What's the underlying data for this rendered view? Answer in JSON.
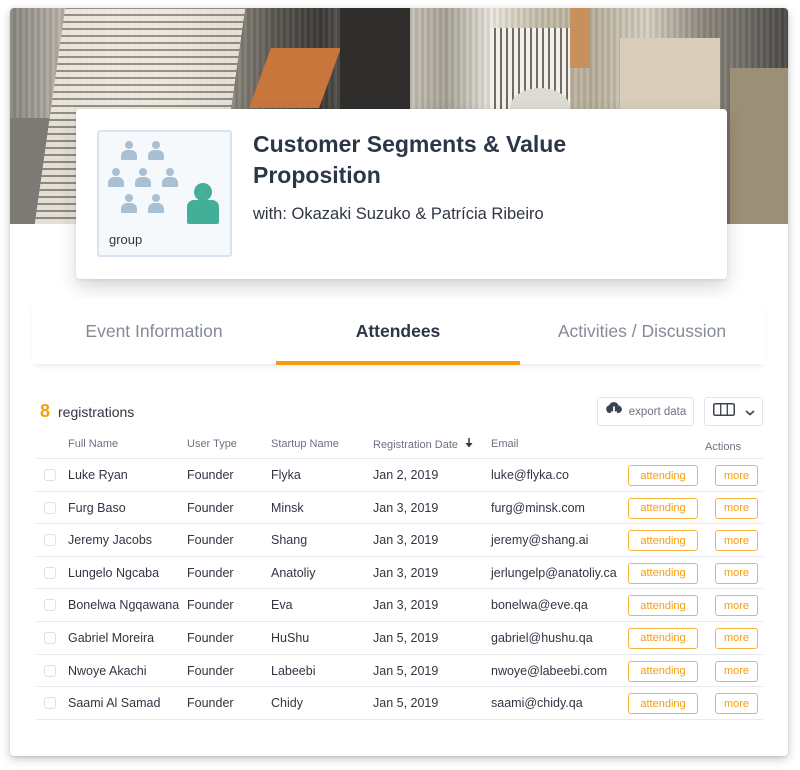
{
  "event": {
    "image_label": "group",
    "title": "Customer Segments & Value Proposition",
    "hosts": "with: Okazaki Suzuko & Patrícia Ribeiro"
  },
  "tabs": [
    {
      "label": "Event Information",
      "active": false
    },
    {
      "label": "Attendees",
      "active": true
    },
    {
      "label": "Activities / Discussion",
      "active": false
    }
  ],
  "registrations": {
    "count": "8",
    "label": "registrations"
  },
  "toolbar": {
    "export_label": "export data",
    "export_icon": "cloud-download-icon",
    "columns_icon": "columns-icon",
    "columns_dropdown_icon": "chevron-down-icon"
  },
  "table": {
    "columns": {
      "name": "Full Name",
      "type": "User Type",
      "startup": "Startup Name",
      "date": "Registration Date",
      "email": "Email",
      "actions": "Actions"
    },
    "sort_icon": "arrow-down-icon",
    "rows": [
      {
        "name": "Luke Ryan",
        "type": "Founder",
        "startup": "Flyka",
        "date": "Jan 2, 2019",
        "email": "luke@flyka.co",
        "status": "attending",
        "more": "more"
      },
      {
        "name": "Furg Baso",
        "type": "Founder",
        "startup": "Minsk",
        "date": "Jan 3, 2019",
        "email": "furg@minsk.com",
        "status": "attending",
        "more": "more"
      },
      {
        "name": "Jeremy Jacobs",
        "type": "Founder",
        "startup": "Shang",
        "date": "Jan 3, 2019",
        "email": "jeremy@shang.ai",
        "status": "attending",
        "more": "more"
      },
      {
        "name": "Lungelo Ngcaba",
        "type": "Founder",
        "startup": "Anatoliy",
        "date": "Jan 3, 2019",
        "email": "jerlungelp@anatoliy.ca",
        "status": "attending",
        "more": "more"
      },
      {
        "name": "Bonelwa Ngqawana",
        "type": "Founder",
        "startup": "Eva",
        "date": "Jan 3, 2019",
        "email": "bonelwa@eve.qa",
        "status": "attending",
        "more": "more"
      },
      {
        "name": "Gabriel Moreira",
        "type": "Founder",
        "startup": "HuShu",
        "date": "Jan 5, 2019",
        "email": "gabriel@hushu.qa",
        "status": "attending",
        "more": "more"
      },
      {
        "name": "Nwoye Akachi",
        "type": "Founder",
        "startup": "Labeebi",
        "date": "Jan 5, 2019",
        "email": "nwoye@labeebi.com",
        "status": "attending",
        "more": "more"
      },
      {
        "name": "Saami Al Samad",
        "type": "Founder",
        "startup": "Chidy",
        "date": "Jan 5, 2019",
        "email": "saami@chidy.qa",
        "status": "attending",
        "more": "more"
      }
    ]
  },
  "colors": {
    "accent": "#f59d0e",
    "group_icon_lead": "#42af96",
    "group_icon_members": "#a9c0d3",
    "title_text": "#2c3648"
  }
}
